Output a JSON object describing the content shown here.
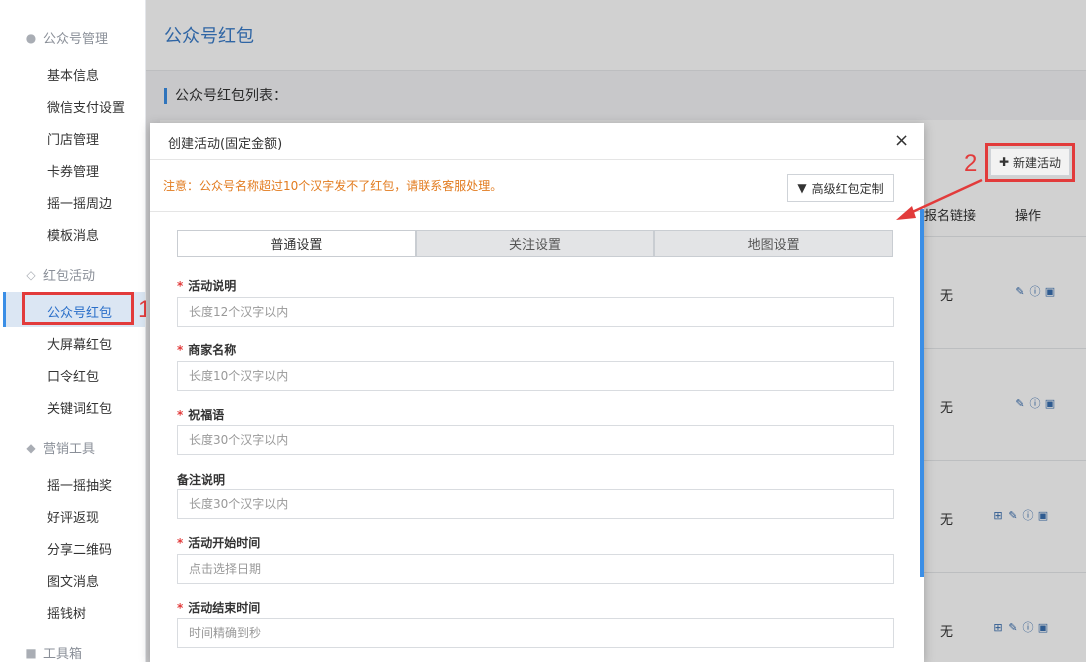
{
  "sidebar": {
    "groups": [
      {
        "label": "公众号管理",
        "icon": "wechat-icon",
        "items": [
          "基本信息",
          "微信支付设置",
          "门店管理",
          "卡券管理",
          "摇一摇周边",
          "模板消息"
        ]
      },
      {
        "label": "红包活动",
        "icon": "diamond-icon",
        "items": [
          "公众号红包",
          "大屏幕红包",
          "口令红包",
          "关键词红包"
        ]
      },
      {
        "label": "营销工具",
        "icon": "tag-icon",
        "items": [
          "摇一摇抽奖",
          "好评返现",
          "分享二维码",
          "图文消息",
          "摇钱树"
        ]
      },
      {
        "label": "工具箱",
        "icon": "briefcase-icon",
        "items": []
      }
    ],
    "active_item": "公众号红包"
  },
  "annotations": {
    "step1": "1",
    "step2": "2"
  },
  "page": {
    "title": "公众号红包",
    "list_title": "公众号红包列表：",
    "new_button": "新建活动",
    "columns": {
      "signup_link": "报名链接",
      "actions": "操作"
    },
    "rows": [
      {
        "signup_link": "无"
      },
      {
        "signup_link": "无"
      },
      {
        "signup_link": "无"
      },
      {
        "signup_link": "无"
      }
    ]
  },
  "modal": {
    "title": "创建活动(固定金额)",
    "close": "×",
    "notice": "注意：公众号名称超过10个汉字发不了红包，请联系客服处理。",
    "advanced_button": "高级红包定制",
    "tabs": [
      "普通设置",
      "关注设置",
      "地图设置"
    ],
    "active_tab": "普通设置",
    "fields": [
      {
        "label": "活动说明",
        "required": true,
        "placeholder": "长度12个汉字以内"
      },
      {
        "label": "商家名称",
        "required": true,
        "placeholder": "长度10个汉字以内"
      },
      {
        "label": "祝福语",
        "required": true,
        "placeholder": "长度30个汉字以内"
      },
      {
        "label": "备注说明",
        "required": false,
        "placeholder": "长度30个汉字以内"
      },
      {
        "label": "活动开始时间",
        "required": true,
        "placeholder": "点击选择日期"
      },
      {
        "label": "活动结束时间",
        "required": true,
        "placeholder": "时间精确到秒"
      }
    ]
  },
  "colors": {
    "accent": "#3a8ee6",
    "highlight": "#e23b3b",
    "notice": "#e27b1f"
  }
}
